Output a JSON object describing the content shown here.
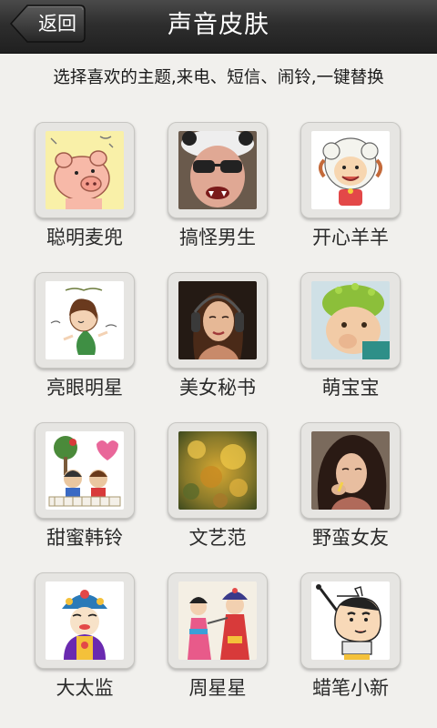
{
  "header": {
    "back_label": "返回",
    "title": "声音皮肤"
  },
  "intro": "选择喜欢的主题,来电、短信、闹铃,一键替换",
  "skins": [
    {
      "label": "聪明麦兜",
      "icon": "pig-cartoon-icon"
    },
    {
      "label": "搞怪男生",
      "icon": "funny-boy-icon"
    },
    {
      "label": "开心羊羊",
      "icon": "happy-sheep-icon"
    },
    {
      "label": "亮眼明星",
      "icon": "star-girl-cartoon-icon"
    },
    {
      "label": "美女秘书",
      "icon": "secretary-photo-icon"
    },
    {
      "label": "萌宝宝",
      "icon": "baby-photo-icon"
    },
    {
      "label": "甜蜜韩铃",
      "icon": "sweet-couple-icon"
    },
    {
      "label": "文艺范",
      "icon": "autumn-leaves-icon"
    },
    {
      "label": "野蛮女友",
      "icon": "girlfriend-photo-icon"
    },
    {
      "label": "大太监",
      "icon": "opera-eunuch-icon"
    },
    {
      "label": "周星星",
      "icon": "opera-duo-icon"
    },
    {
      "label": "蜡笔小新",
      "icon": "crayon-shinchan-icon"
    }
  ]
}
